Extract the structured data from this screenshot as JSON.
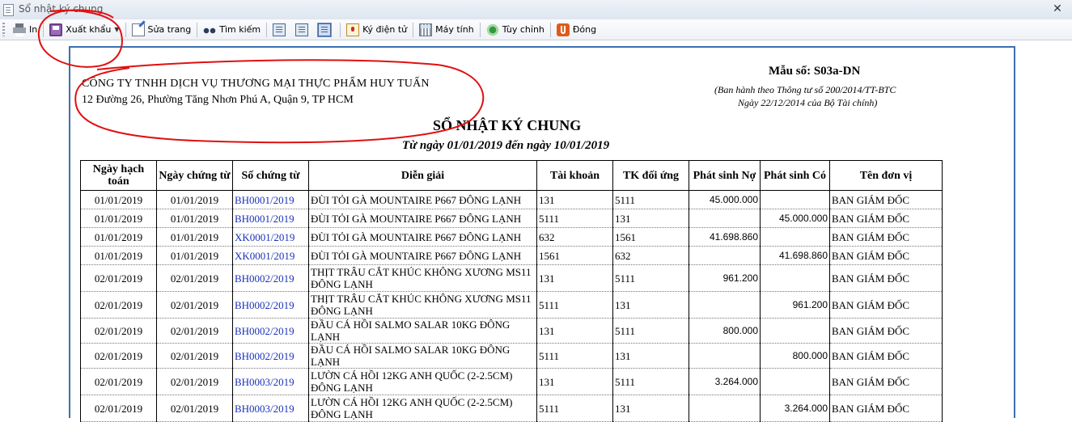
{
  "window": {
    "title": "Sổ nhật ký chung",
    "close": "✕"
  },
  "toolbar": {
    "print": "In",
    "export": "Xuất khẩu",
    "edit_page": "Sửa trang",
    "find": "Tìm kiếm",
    "e_sign": "Ký điện tử",
    "calculator": "Máy tính",
    "options": "Tùy chỉnh",
    "close": "Đóng"
  },
  "report": {
    "company": "CÔNG TY TNHH DỊCH VỤ THƯƠNG MẠI THỰC PHẨM HUY TUẤN",
    "address": "12 Đường 26, Phường Tăng Nhơn Phú A, Quận 9, TP HCM",
    "form_no": "Mẫu số: S03a-DN",
    "form_note_1": "(Ban hành theo Thông tư số 200/2014/TT-BTC",
    "form_note_2": "Ngày 22/12/2014 của Bộ Tài chính)",
    "title": "SỔ NHẬT KÝ CHUNG",
    "period": "Từ ngày 01/01/2019 đến ngày 10/01/2019"
  },
  "table": {
    "headers": [
      "Ngày hạch toán",
      "Ngày chứng từ",
      "Số chứng từ",
      "Diễn giải",
      "Tài khoản",
      "TK đối ứng",
      "Phát sinh Nợ",
      "Phát sinh Có",
      "Tên đơn vị"
    ],
    "rows": [
      [
        "01/01/2019",
        "01/01/2019",
        "BH0001/2019",
        "ĐÙI TỎI GÀ MOUNTAIRE P667 ĐÔNG LẠNH",
        "131",
        "5111",
        "45.000.000",
        "",
        "BAN GIÁM ĐỐC"
      ],
      [
        "01/01/2019",
        "01/01/2019",
        "BH0001/2019",
        "ĐÙI TỎI GÀ MOUNTAIRE P667 ĐÔNG LẠNH",
        "5111",
        "131",
        "",
        "45.000.000",
        "BAN GIÁM ĐỐC"
      ],
      [
        "01/01/2019",
        "01/01/2019",
        "XK0001/2019",
        "ĐÙI TỎI GÀ MOUNTAIRE P667 ĐÔNG LẠNH",
        "632",
        "1561",
        "41.698.860",
        "",
        "BAN GIÁM ĐỐC"
      ],
      [
        "01/01/2019",
        "01/01/2019",
        "XK0001/2019",
        "ĐÙI TỎI GÀ MOUNTAIRE P667 ĐÔNG LẠNH",
        "1561",
        "632",
        "",
        "41.698.860",
        "BAN GIÁM ĐỐC"
      ],
      [
        "02/01/2019",
        "02/01/2019",
        "BH0002/2019",
        "THỊT TRÂU CẮT KHÚC KHÔNG XƯƠNG MS11 ĐÔNG LẠNH",
        "131",
        "5111",
        "961.200",
        "",
        "BAN GIÁM ĐỐC"
      ],
      [
        "02/01/2019",
        "02/01/2019",
        "BH0002/2019",
        "THỊT TRÂU CẮT KHÚC KHÔNG XƯƠNG MS11 ĐÔNG LẠNH",
        "5111",
        "131",
        "",
        "961.200",
        "BAN GIÁM ĐỐC"
      ],
      [
        "02/01/2019",
        "02/01/2019",
        "BH0002/2019",
        "ĐẦU CÁ HỒI SALMO SALAR 10KG ĐÔNG LẠNH",
        "131",
        "5111",
        "800.000",
        "",
        "BAN GIÁM ĐỐC"
      ],
      [
        "02/01/2019",
        "02/01/2019",
        "BH0002/2019",
        "ĐẦU CÁ HỒI SALMO SALAR 10KG ĐÔNG LẠNH",
        "5111",
        "131",
        "",
        "800.000",
        "BAN GIÁM ĐỐC"
      ],
      [
        "02/01/2019",
        "02/01/2019",
        "BH0003/2019",
        "LƯỜN CÁ HỒI 12KG ANH QUỐC (2-2.5CM) ĐÔNG LẠNH",
        "131",
        "5111",
        "3.264.000",
        "",
        "BAN GIÁM ĐỐC"
      ],
      [
        "02/01/2019",
        "02/01/2019",
        "BH0003/2019",
        "LƯỜN CÁ HỒI 12KG ANH QUỐC (2-2.5CM) ĐÔNG LẠNH",
        "5111",
        "131",
        "",
        "3.264.000",
        "BAN GIÁM ĐỐC"
      ]
    ]
  },
  "colors": {
    "annotation": "#e01010",
    "doc_link": "#1a32b8",
    "page_border": "#3b6fb0"
  }
}
